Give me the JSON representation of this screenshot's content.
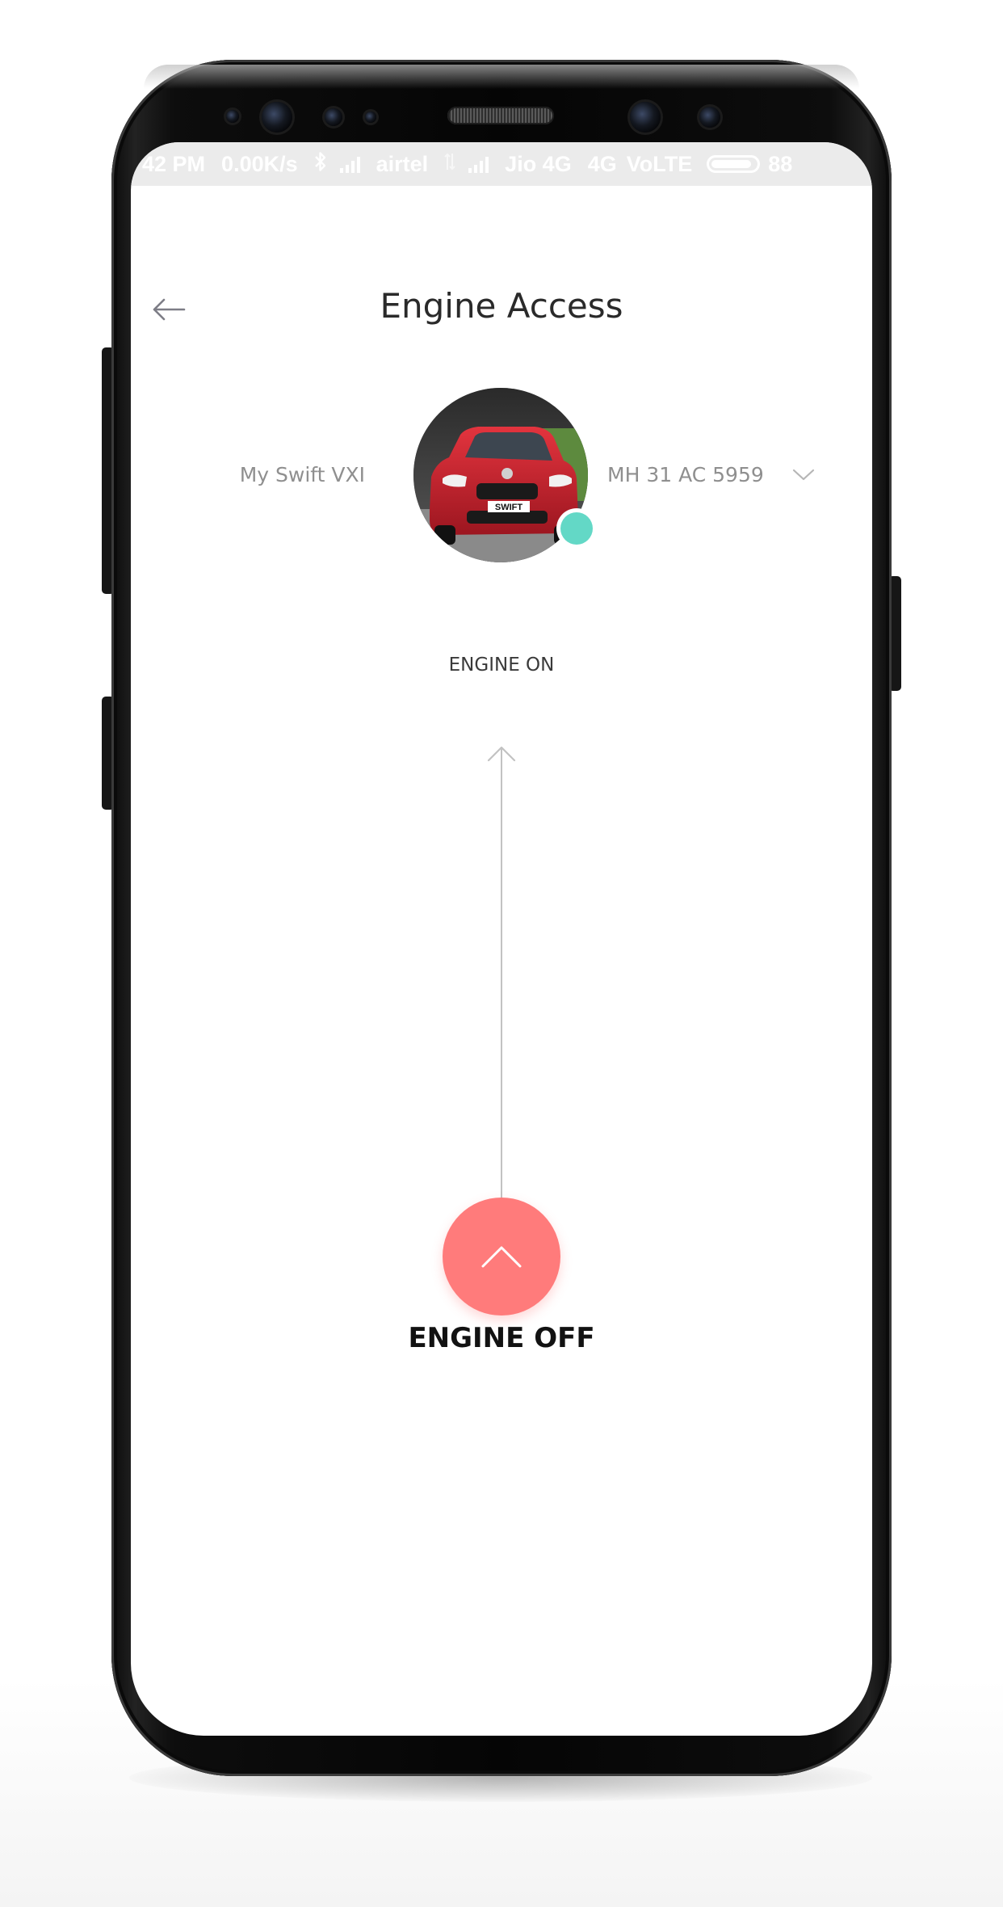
{
  "status_bar": {
    "time": "42 PM",
    "network_speed": "0.00K/s",
    "bluetooth_icon": "bluetooth-icon",
    "carrier_1": "airtel",
    "carrier_2": "Jio 4G",
    "network_type": "4G",
    "volte": "VoLTE",
    "battery": "88"
  },
  "header": {
    "back_icon": "arrow-left-icon",
    "title": "Engine Access"
  },
  "vehicle": {
    "name": "My Swift VXI",
    "plate": "MH 31 AC 5959",
    "dropdown_icon": "chevron-down-icon",
    "badge_text": "SWIFT",
    "status_color": "#63d8c6"
  },
  "engine_control": {
    "target_label": "ENGINE ON",
    "current_label": "ENGINE OFF",
    "slide_icon": "chevron-up-icon",
    "button_color": "#ff7b7b"
  }
}
